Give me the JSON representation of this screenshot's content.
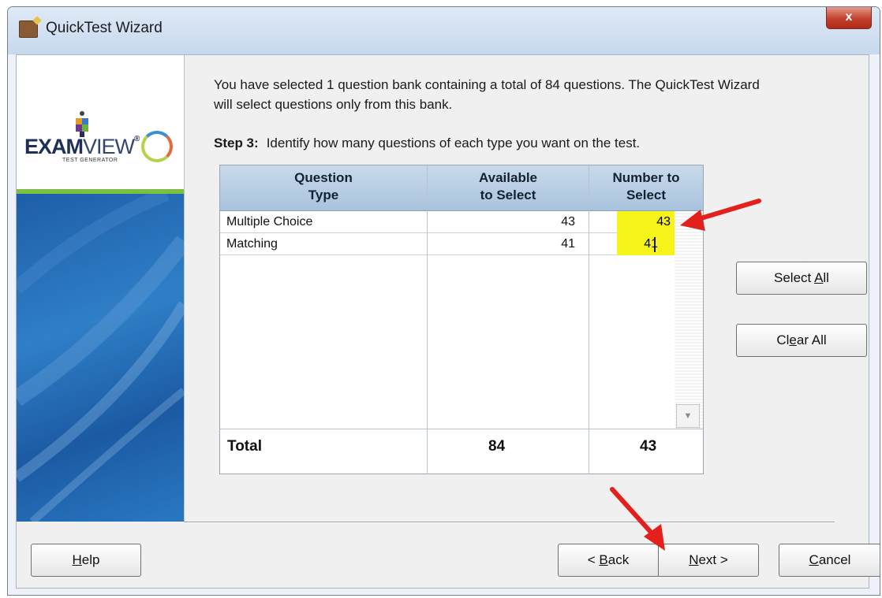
{
  "window": {
    "title": "QuickTest Wizard",
    "close_glyph": "x"
  },
  "logo": {
    "brand_bold": "EXAM",
    "brand_thin": "VIEW",
    "reg": "®",
    "subtitle": "TEST GENERATOR"
  },
  "intro": {
    "line1": "You have selected 1 question bank containing a total of 84 questions.  The QuickTest Wizard",
    "line2": "will select questions only from this bank."
  },
  "step": {
    "label": "Step 3:",
    "text": "Identify how many questions of each type you want on the test."
  },
  "table": {
    "headers": [
      {
        "line1": "Question",
        "line2": "Type"
      },
      {
        "line1": "Available",
        "line2": "to Select"
      },
      {
        "line1": "Number to",
        "line2": "Select"
      }
    ],
    "rows": [
      {
        "type": "Multiple Choice",
        "available": "43",
        "number": "43"
      },
      {
        "type": "Matching",
        "available": "41",
        "number": "41"
      }
    ],
    "totals": {
      "label": "Total",
      "available": "84",
      "number": "43"
    }
  },
  "buttons": {
    "select_all_pre": "Select ",
    "select_all_u": "A",
    "select_all_post": "ll",
    "clear_all_pre": "Cl",
    "clear_all_u": "e",
    "clear_all_post": "ar All",
    "help_u": "H",
    "help_post": "elp",
    "back_pre": "< ",
    "back_u": "B",
    "back_post": "ack",
    "next_u": "N",
    "next_post": "ext >",
    "cancel_u": "C",
    "cancel_post": "ancel"
  },
  "icons": {
    "scroll_down": "▼"
  },
  "colors": {
    "highlight": "#f6f41a",
    "annotation_arrow": "#e3201b",
    "header_blue": "#a9c3dd",
    "sidebar_blue": "#2a78c2",
    "sidebar_green": "#7cc043"
  }
}
